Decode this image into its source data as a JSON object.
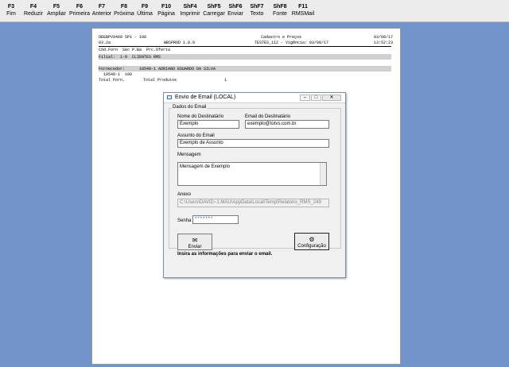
{
  "toolbar": {
    "f3": {
      "key": "F3",
      "label": "Fim"
    },
    "f4": {
      "key": "F4",
      "label": "Reduzir"
    },
    "f5": {
      "key": "F5",
      "label": "Ampliar"
    },
    "f6": {
      "key": "F6",
      "label": "Primeira"
    },
    "f7": {
      "key": "F7",
      "label": "Anterior"
    },
    "f8": {
      "key": "F8",
      "label": "Próxima"
    },
    "f9": {
      "key": "F9",
      "label": "Última"
    },
    "f10": {
      "key": "F10",
      "label": "Página"
    },
    "sf4": {
      "key": "ShF4",
      "label": "Imprimir"
    },
    "sf5": {
      "key": "ShF5",
      "label": "Carregar"
    },
    "sf6": {
      "key": "ShF6",
      "label": "Enviar"
    },
    "sf7": {
      "key": "ShF7",
      "label": "Texto"
    },
    "sf8": {
      "key": "ShF8",
      "label": "Fonte"
    },
    "f11": {
      "key": "F11",
      "label": "RMSMail"
    }
  },
  "report": {
    "header_left1": "DEEBPV9468 SP1 - 100",
    "header_left2": "03.2a",
    "header_mid1": "WBSPROD 1.0.0",
    "header_mid2": "Cadastro e Preços",
    "header_right_system": "TESTES_112 - Vigência: 03/08/17",
    "header_right_date": "03/08/17",
    "header_right_time": "13:52:23",
    "columns": "Cód.Forn  Sec P.Ba  Prc.Oferta",
    "filial": "Filial:  1-9  CLIENTES RMS",
    "fornecedor": "Fornecedor:      10548-1 ADRIANO EDUARDO DA SILVA",
    "line1": "  10548-1  100",
    "total_forn": "Total Forn.",
    "total_produtos": "Total Produtos",
    "total_value": "1"
  },
  "dialog": {
    "title": "Envio de Email (LOCAL)",
    "group_label": "Dados do Email",
    "nome_label": "Nome do Destinatário",
    "nome_value": "Exemplo",
    "email_label": "Email do Destinatário",
    "email_value": "exemplo@totvs.com.br",
    "assunto_label": "Assunto do Email",
    "assunto_value": "Exemplo de Assunto",
    "mensagem_label": "Mensagem",
    "mensagem_value": "Mensagem de Exemplo",
    "anexo_label": "Anexo",
    "anexo_value": "C:\\Users\\DAVID~1.MAU\\AppData\\Local\\Temp\\Relatorio_RMS_249",
    "senha_label": "Senha",
    "senha_value": "*******",
    "enviar_label": "Enviar",
    "config_label": "Configuração",
    "info_text": "Insira as informações para enviar o email."
  }
}
